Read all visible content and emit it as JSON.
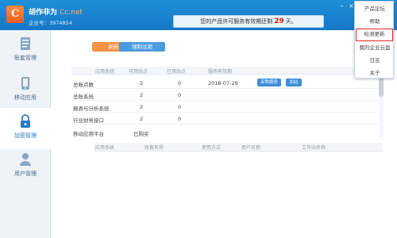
{
  "header": {
    "brand_name": "胡作非为",
    "brand_suffix": "Cc.net",
    "company_code_label": "企业号：",
    "company_code": "3974854",
    "notice_prefix": "您的产品许可服务有效期还剩",
    "notice_days": "29",
    "notice_suffix": "天。",
    "minimize_icon": "minimize-icon",
    "close_icon": "close-icon"
  },
  "sidebar": {
    "items": [
      {
        "label": "账套管理",
        "icon": "account-book-icon",
        "active": false
      },
      {
        "label": "移动应用",
        "icon": "mobile-icon",
        "active": false
      },
      {
        "label": "加密管理",
        "icon": "lock-icon",
        "active": true
      },
      {
        "label": "用户管理",
        "icon": "user-icon",
        "active": false
      }
    ]
  },
  "toolbar": {
    "refresh_label": "刷新",
    "force_logout_label": "强制注销"
  },
  "apps_table": {
    "columns": [
      "应用系统",
      "可用站点",
      "已用站点",
      "服务有效期"
    ],
    "rows": [
      {
        "system": "总账点数",
        "available": "2",
        "used": "0",
        "expiry": "2018-07-29",
        "buy_label": "采购服务",
        "add_label": "加站"
      },
      {
        "system": "总账系统",
        "available": "2",
        "used": "0",
        "expiry": "",
        "buy_label": "",
        "add_label": ""
      },
      {
        "system": "报表与分析系统",
        "available": "2",
        "used": "0",
        "expiry": "",
        "buy_label": "",
        "add_label": ""
      },
      {
        "system": "行业财务接口",
        "available": "2",
        "used": "0",
        "expiry": "",
        "buy_label": "",
        "add_label": ""
      },
      {
        "system": "移动应用平台",
        "available": "已购买",
        "used": "",
        "expiry": "",
        "buy_label": "",
        "add_label": ""
      }
    ]
  },
  "sessions_table": {
    "columns": [
      "应用系统",
      "账套名称",
      "使用方式",
      "用户名称",
      "工作站名称"
    ]
  },
  "menu": {
    "items": [
      "产品论坛",
      "帮助",
      "检测更新",
      "我的企业云盘",
      "日志",
      "关于"
    ],
    "highlighted_index": 2,
    "highlight_color": "#e0262a"
  },
  "colors": {
    "header_blue": "#1677c8",
    "accent_orange": "#f79344",
    "accent_blue": "#4a9be0",
    "days_red": "#e0201a"
  }
}
